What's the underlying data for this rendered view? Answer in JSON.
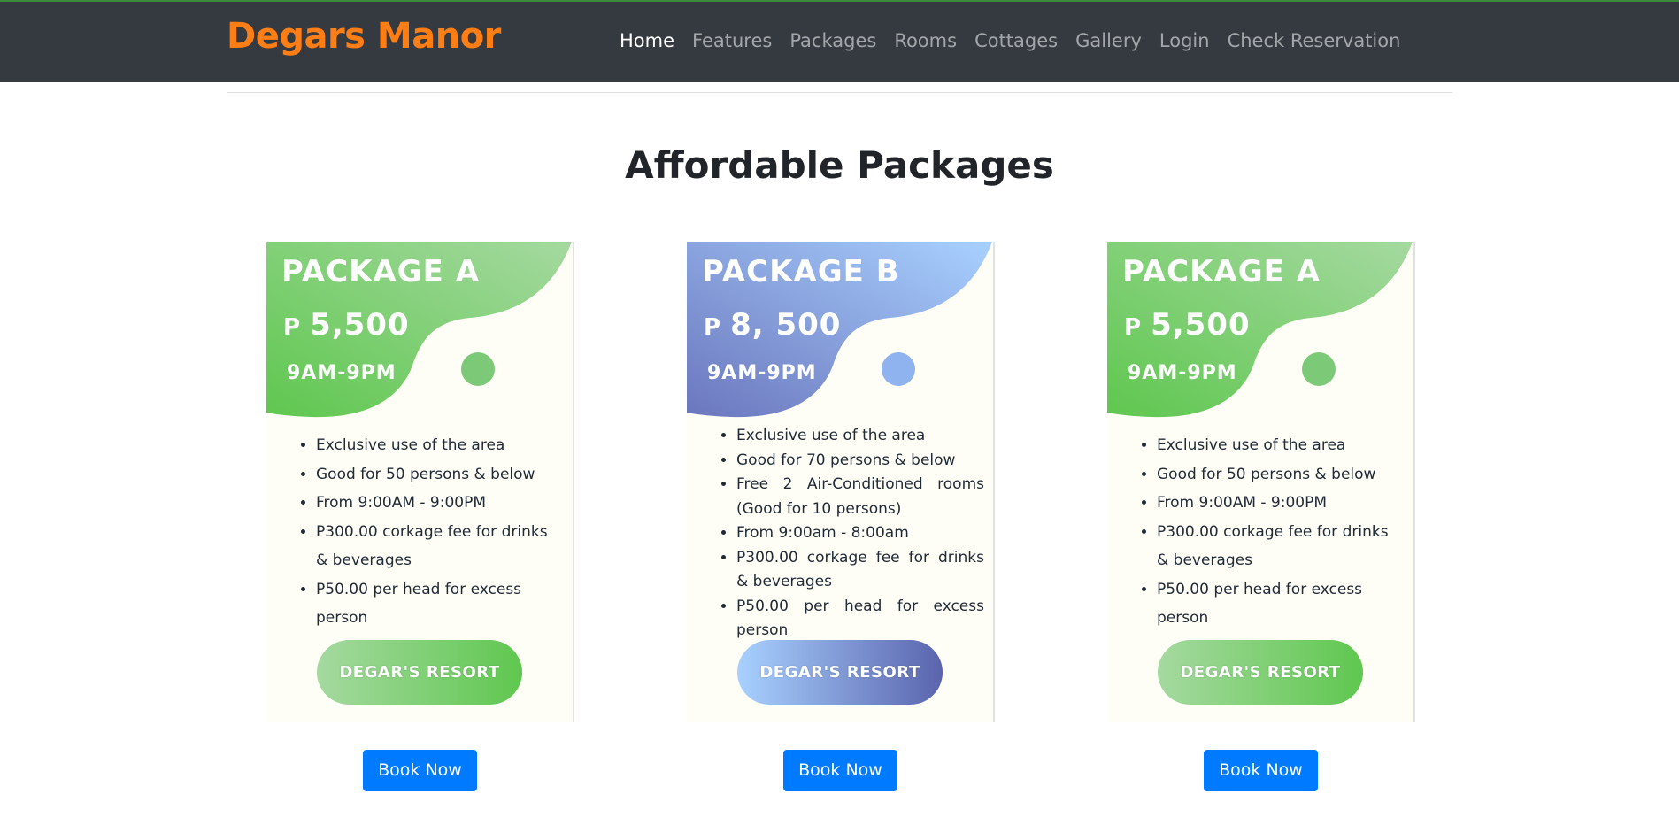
{
  "brand": "Degars Manor",
  "nav": {
    "items": [
      "Home",
      "Features",
      "Packages",
      "Rooms",
      "Cottages",
      "Gallery",
      "Login",
      "Check Reservation"
    ],
    "active": "Home"
  },
  "section_title": "Affordable Packages",
  "packages": [
    {
      "name": "PACKAGE A",
      "currency": "P",
      "price": "5,500",
      "hours": "9AM-9PM",
      "features": [
        "Exclusive use of the area",
        "Good for 50 persons & below",
        "From 9:00AM - 9:00PM",
        "P300.00 corkage fee for drinks & beverages",
        "P50.00 per head for excess person"
      ],
      "badge": "DEGAR'S RESORT",
      "book_label": "Book Now"
    },
    {
      "name": "PACKAGE B",
      "currency": "P",
      "price": "8, 500",
      "hours": "9AM-9PM",
      "features": [
        "Exclusive use of the area",
        "Good for 70 persons & below",
        "Free 2 Air-Conditioned rooms (Good for 10 persons)",
        "From 9:00am - 8:00am",
        "P300.00 corkage fee for drinks & beverages",
        "P50.00 per head for excess person"
      ],
      "badge": "DEGAR'S RESORT",
      "book_label": "Book Now"
    },
    {
      "name": "PACKAGE A",
      "currency": "P",
      "price": "5,500",
      "hours": "9AM-9PM",
      "features": [
        "Exclusive use of the area",
        "Good for 50 persons & below",
        "From 9:00AM - 9:00PM",
        "P300.00 corkage fee for drinks & beverages",
        "P50.00 per head for excess person"
      ],
      "badge": "DEGAR'S RESORT",
      "book_label": "Book Now"
    }
  ],
  "colors": {
    "navbar": "#343a40",
    "brand": "#fd7e14",
    "button": "#007bff",
    "green_start": "#5fc74f",
    "green_end": "#a5d9a0",
    "blue_start": "#6e7bc0",
    "blue_end": "#a9d2ff"
  }
}
